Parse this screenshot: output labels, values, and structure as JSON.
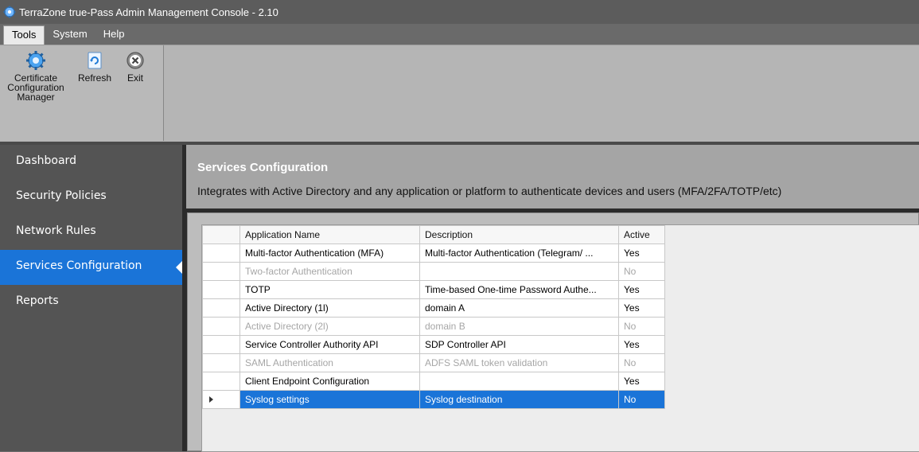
{
  "window": {
    "title": "TerraZone true-Pass Admin Management Console  - 2.10",
    "icon": "gear-icon"
  },
  "menu": {
    "tabs": [
      {
        "label": "Tools",
        "active": true
      },
      {
        "label": "System",
        "active": false
      },
      {
        "label": "Help",
        "active": false
      }
    ]
  },
  "ribbon": {
    "buttons": [
      {
        "label": "Certificate Configuration Manager",
        "icon": "gear-icon"
      },
      {
        "label": "Refresh",
        "icon": "refresh-icon"
      },
      {
        "label": "Exit",
        "icon": "close-icon"
      }
    ]
  },
  "sidebar": {
    "items": [
      {
        "label": "Dashboard",
        "active": false
      },
      {
        "label": "Security Policies",
        "active": false
      },
      {
        "label": "Network Rules",
        "active": false
      },
      {
        "label": "Services Configuration",
        "active": true
      },
      {
        "label": "Reports",
        "active": false
      }
    ]
  },
  "header": {
    "title": "Services Configuration",
    "subtitle": "Integrates with Active Directory and any application or platform to authenticate devices and users (MFA/2FA/TOTP/etc)"
  },
  "grid": {
    "columns": [
      "Application Name",
      "Description",
      "Active"
    ],
    "rows": [
      {
        "name": "Multi-factor Authentication (MFA)",
        "description": "Multi-factor Authentication (Telegram/ ...",
        "active": "Yes",
        "enabled": true,
        "selected": false
      },
      {
        "name": "Two-factor Authentication",
        "description": "",
        "active": "No",
        "enabled": false,
        "selected": false
      },
      {
        "name": "TOTP",
        "description": "Time-based One-time Password Authe...",
        "active": "Yes",
        "enabled": true,
        "selected": false
      },
      {
        "name": "Active Directory (1l)",
        "description": "domain A",
        "active": "Yes",
        "enabled": true,
        "selected": false
      },
      {
        "name": "Active Directory (2l)",
        "description": "domain B",
        "active": "No",
        "enabled": false,
        "selected": false
      },
      {
        "name": "Service Controller Authority API",
        "description": "SDP Controller API",
        "active": "Yes",
        "enabled": true,
        "selected": false
      },
      {
        "name": "SAML Authentication",
        "description": "ADFS SAML token validation",
        "active": "No",
        "enabled": false,
        "selected": false
      },
      {
        "name": "Client Endpoint Configuration",
        "description": "",
        "active": "Yes",
        "enabled": true,
        "selected": false
      },
      {
        "name": "Syslog settings",
        "description": "Syslog destination",
        "active": "No",
        "enabled": true,
        "selected": true
      }
    ]
  },
  "colors": {
    "accent": "#1a74d8",
    "sidebar_bg": "#545454",
    "header_bg": "#a5a5a5"
  }
}
